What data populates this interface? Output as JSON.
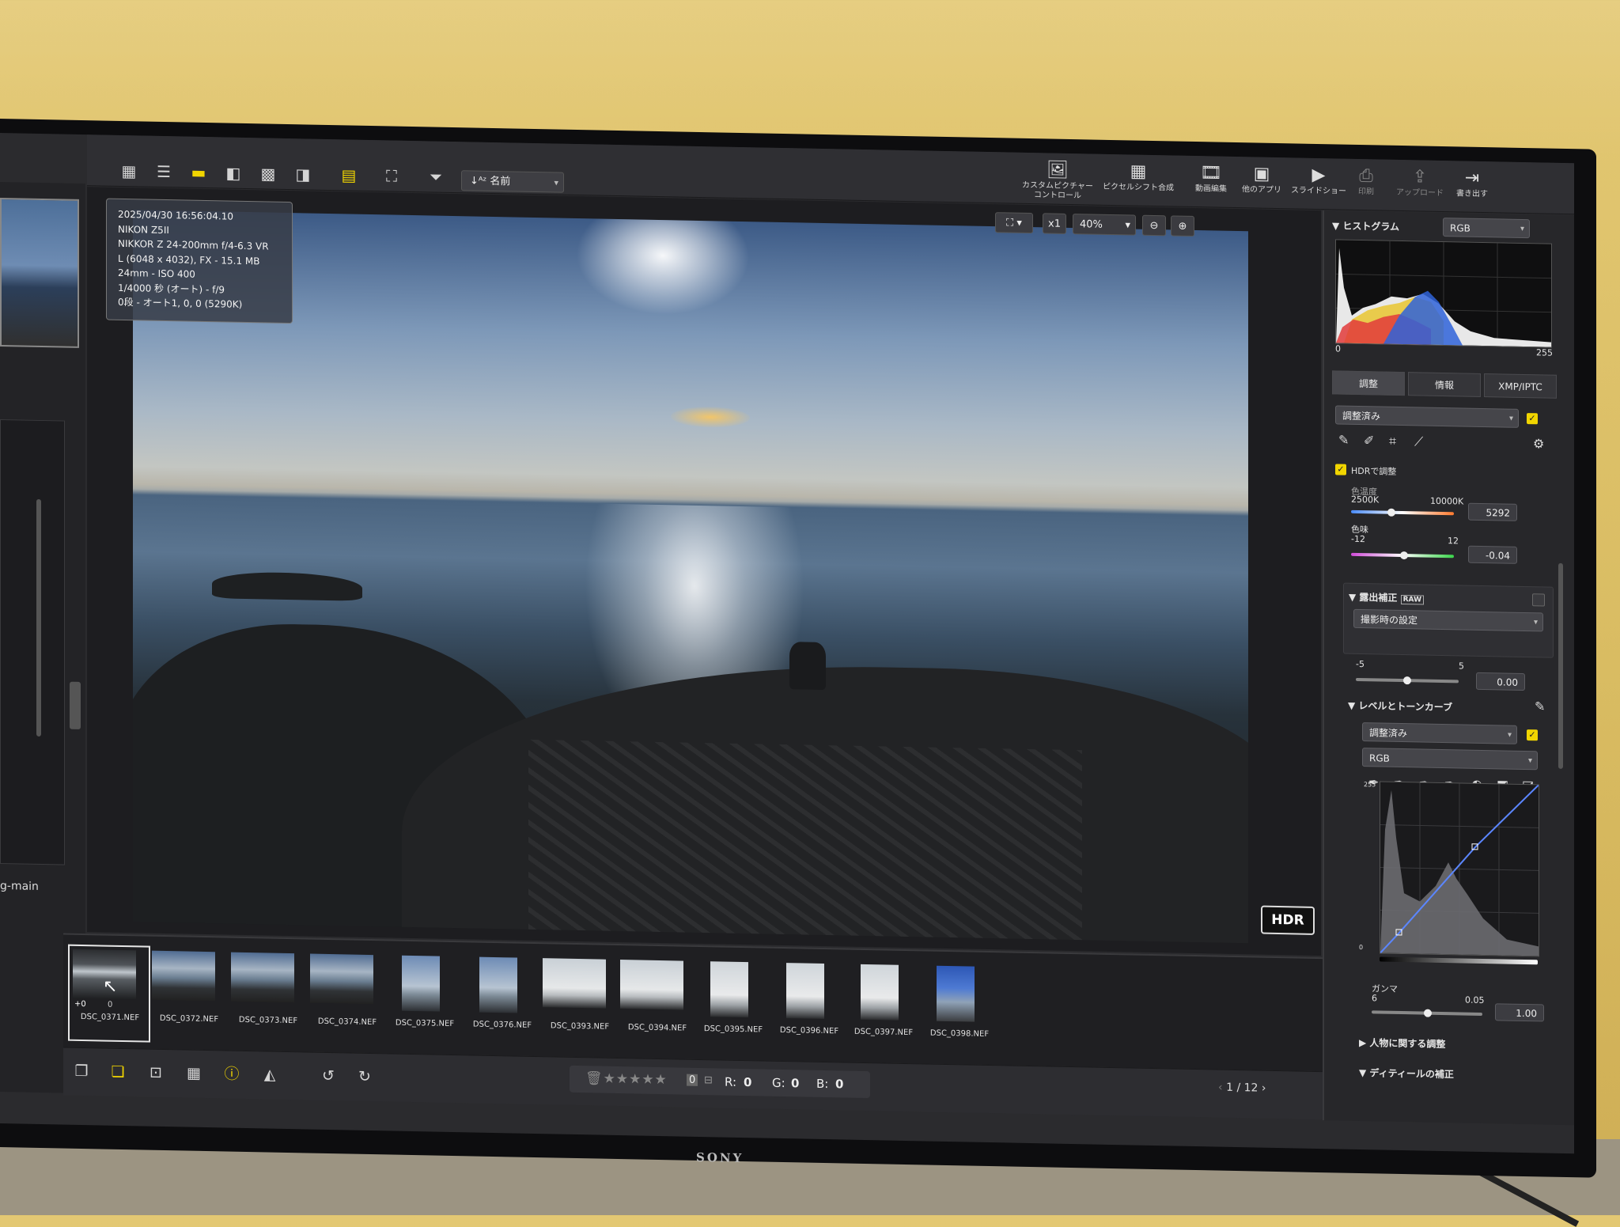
{
  "toolbar": {
    "sort_label": "名前",
    "tools": [
      {
        "label": "カスタムピクチャー\nコントロール",
        "icon": "custom-picture-icon"
      },
      {
        "label": "ピクセルシフト合成",
        "icon": "pixel-shift-icon"
      },
      {
        "label": "動画編集",
        "icon": "movie-edit-icon"
      },
      {
        "label": "他のアプリ",
        "icon": "other-apps-icon"
      },
      {
        "label": "スライドショー",
        "icon": "slideshow-icon"
      },
      {
        "label": "印刷",
        "icon": "print-icon"
      },
      {
        "label": "アップロード",
        "icon": "upload-icon"
      },
      {
        "label": "書き出す",
        "icon": "export-icon"
      }
    ]
  },
  "zoom": {
    "fit_label": "x1",
    "level": "40%"
  },
  "photo_info": {
    "lines": [
      "2025/04/30 16:56:04.10",
      "NIKON Z5II",
      "NIKKOR Z 24-200mm f/4-6.3 VR",
      "L (6048 x 4032), FX - 15.1 MB",
      "24mm - ISO 400",
      "1/4000 秒 (オート) - f/9",
      "0段 - オート1, 0, 0 (5290K)"
    ],
    "hdr_badge": "HDR"
  },
  "left_sidebar": {
    "text": "g-main"
  },
  "filmstrip": {
    "thumbs": [
      {
        "name": "DSC_0371.NEF",
        "style": "dark"
      },
      {
        "name": "DSC_0372.NEF",
        "style": "land"
      },
      {
        "name": "DSC_0373.NEF",
        "style": "land"
      },
      {
        "name": "DSC_0374.NEF",
        "style": "land"
      },
      {
        "name": "DSC_0375.NEF",
        "style": "portrait"
      },
      {
        "name": "DSC_0376.NEF",
        "style": "portrait"
      },
      {
        "name": "DSC_0393.NEF",
        "style": "bright"
      },
      {
        "name": "DSC_0394.NEF",
        "style": "bright"
      },
      {
        "name": "DSC_0395.NEF",
        "style": "bright-portrait"
      },
      {
        "name": "DSC_0396.NEF",
        "style": "bright-portrait"
      },
      {
        "name": "DSC_0397.NEF",
        "style": "bright-portrait"
      },
      {
        "name": "DSC_0398.NEF",
        "style": "blue-portrait"
      }
    ],
    "selected_badge": "+0",
    "selected_count": "0"
  },
  "bottombar": {
    "stars": "★★★★★",
    "rating_count": "0",
    "r_label": "R:",
    "r_value": "0",
    "g_label": "G:",
    "g_value": "0",
    "b_label": "B:",
    "b_value": "0",
    "page_current": "1",
    "page_sep": "/",
    "page_total": "12"
  },
  "histogram": {
    "title": "ヒストグラム",
    "channel": "RGB",
    "axis_min": "0",
    "axis_max": "255"
  },
  "panel_tabs": [
    "調整",
    "情報",
    "XMP/IPTC"
  ],
  "adjust": {
    "preset": "調整済み",
    "hdr_label": "HDRで調整",
    "wb_label": "色温度",
    "wb_min": "2500K",
    "wb_max": "10000K",
    "wb_value": "5292",
    "tint_label": "色味",
    "tint_min": "-12",
    "tint_max": "12",
    "tint_value": "-0.04",
    "exposure_title": "露出補正",
    "exposure_tag": "RAW",
    "exposure_preset": "撮影時の設定",
    "exposure_min": "-5",
    "exposure_max": "5",
    "exposure_value": "0.00",
    "levels_title": "レベルとトーンカーブ",
    "levels_preset": "調整済み",
    "levels_channel": "RGB",
    "curve_max": "255",
    "curve_min": "0",
    "gamma_label": "ガンマ",
    "gamma_min": "6",
    "gamma_max": "0.05",
    "gamma_value": "1.00",
    "section_people": "人物に関する調整",
    "section_detail": "ディティールの補正"
  },
  "colors": {
    "accent": "#f1d500",
    "panel_bg": "#27272a"
  }
}
